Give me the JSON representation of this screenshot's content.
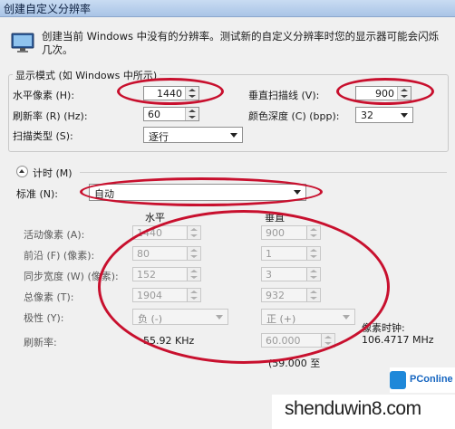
{
  "window": {
    "title": "创建自定义分辨率"
  },
  "description": "创建当前 Windows 中没有的分辨率。测试新的自定义分辨率时您的显示器可能会闪烁几次。",
  "display_mode": {
    "heading": "显示模式 (如 Windows 中所示)",
    "horizontal_pixels": {
      "label": "水平像素 (H):",
      "value": "1440"
    },
    "vertical_scanlines": {
      "label": "垂直扫描线 (V):",
      "value": "900"
    },
    "refresh_rate": {
      "label": "刷新率 (R) (Hz):",
      "value": "60"
    },
    "color_depth": {
      "label": "颜色深度 (C) (bpp):",
      "value": "32"
    },
    "scan_type": {
      "label": "扫描类型 (S):",
      "value": "逐行"
    }
  },
  "timing": {
    "heading": "计时 (M)",
    "standard": {
      "label": "标准 (N):",
      "value": "自动"
    },
    "col_horizontal": "水平",
    "col_vertical": "垂直",
    "rows": [
      {
        "label": "活动像素 (A):",
        "h": "1440",
        "v": "900"
      },
      {
        "label": "前沿 (F) (像素):",
        "h": "80",
        "v": "1"
      },
      {
        "label": "同步宽度 (W) (像素):",
        "h": "152",
        "v": "3"
      },
      {
        "label": "总像素 (T):",
        "h": "1904",
        "v": "932"
      }
    ],
    "polarity": {
      "label": "极性 (Y):",
      "h": "负 (-)",
      "v": "正 (+)"
    },
    "pixel_clock_label": "像素时钟:",
    "pixel_clock_value": "106.4717 MHz",
    "refresh_label": "刷新率:",
    "h_refresh": "55.92 KHz",
    "v_refresh": "60.000",
    "v_refresh_note": "(59.000 至"
  },
  "watermark": {
    "site": "shenduwin8.com",
    "brand": "PConline"
  },
  "colors": {
    "annotation": "#c8102e"
  }
}
